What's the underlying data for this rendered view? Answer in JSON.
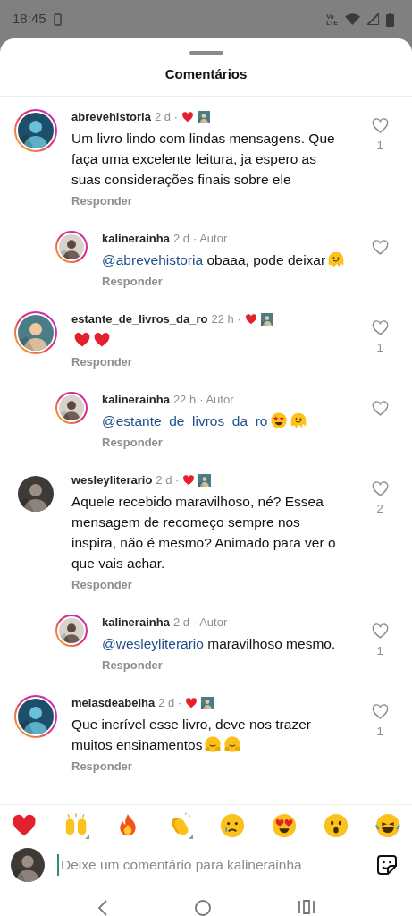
{
  "status_bar": {
    "time": "18:45",
    "network_labels": [
      "Vo",
      "LTE"
    ]
  },
  "sheet": {
    "title": "Comentários"
  },
  "comments": [
    {
      "user": "abrevehistoria",
      "time": "2 d ·",
      "ring": true,
      "liked_by_author": true,
      "liked": false,
      "like_count": "1",
      "reply_label": "Responder",
      "body": [
        {
          "kind": "text",
          "text": "Um livro lindo com lindas mensagens. Que faça uma excelente leitura, ja espero as suas considerações finais sobre ele"
        }
      ],
      "replies": [
        {
          "user": "kalinerainha",
          "time": "2 d",
          "role": "· Autor",
          "ring": true,
          "liked": false,
          "reply_label": "Responder",
          "body": [
            {
              "kind": "mention",
              "text": "@abrevehistoria"
            },
            {
              "kind": "text",
              "text": " obaaa, pode deixar"
            },
            {
              "kind": "melting"
            }
          ]
        }
      ]
    },
    {
      "user": "estante_de_livros_da_ro",
      "time": "22 h ·",
      "ring": true,
      "liked_by_author": true,
      "liked": false,
      "like_count": "1",
      "reply_label": "Responder",
      "body": [
        {
          "kind": "heart"
        },
        {
          "kind": "heart"
        }
      ],
      "replies": [
        {
          "user": "kalinerainha",
          "time": "22 h",
          "role": "· Autor",
          "ring": true,
          "liked": false,
          "reply_label": "Responder",
          "body": [
            {
              "kind": "mention",
              "text": "@estante_de_livros_da_ro"
            },
            {
              "kind": "star-struck"
            },
            {
              "kind": "melting"
            }
          ]
        }
      ]
    },
    {
      "user": "wesleyliterario",
      "time": "2 d ·",
      "ring": false,
      "liked_by_author": true,
      "liked": false,
      "like_count": "2",
      "reply_label": "Responder",
      "body": [
        {
          "kind": "text",
          "text": "Aquele recebido maravilhoso, né? Essea mensagem de recomeço sempre nos inspira, não é mesmo? Animado para ver o que vais achar."
        }
      ],
      "replies": [
        {
          "user": "kalinerainha",
          "time": "2 d",
          "role": "· Autor",
          "ring": true,
          "liked": false,
          "like_count": "1",
          "reply_label": "Responder",
          "body": [
            {
              "kind": "mention",
              "text": "@wesleyliterario"
            },
            {
              "kind": "text",
              "text": " maravilhoso mesmo."
            }
          ]
        }
      ]
    },
    {
      "user": "meiasdeabelha",
      "time": "2 d ·",
      "ring": true,
      "liked_by_author": true,
      "liked": false,
      "like_count": "1",
      "reply_label": "Responder",
      "body": [
        {
          "kind": "text",
          "text": "Que incrível esse livro, deve nos trazer muitos ensinamentos"
        },
        {
          "kind": "hugging"
        },
        {
          "kind": "hugging"
        }
      ]
    }
  ],
  "emoji_bar": [
    {
      "kind": "heart",
      "variants": false
    },
    {
      "kind": "raised-hands",
      "variants": true
    },
    {
      "kind": "fire",
      "variants": false
    },
    {
      "kind": "clap",
      "variants": true
    },
    {
      "kind": "crying",
      "variants": false
    },
    {
      "kind": "heart-eyes",
      "variants": false
    },
    {
      "kind": "surprised",
      "variants": false
    },
    {
      "kind": "tears-of-joy",
      "variants": false
    }
  ],
  "composer": {
    "placeholder": "Deixe um comentário para kalinerainha",
    "focused": true
  }
}
